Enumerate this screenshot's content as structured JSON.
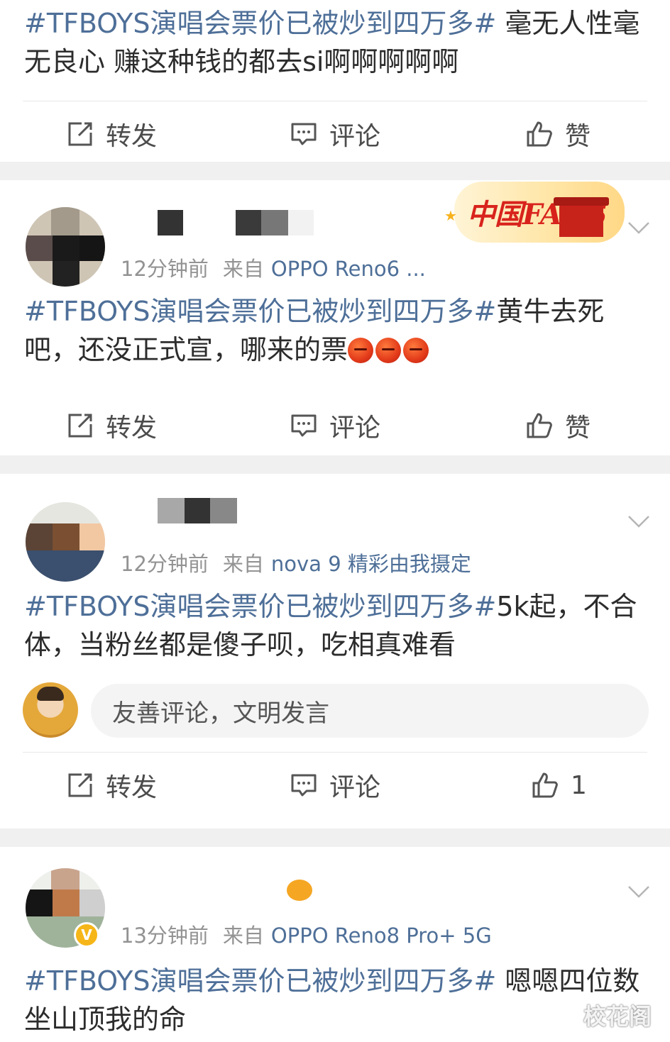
{
  "actions": {
    "repost": "转发",
    "comment": "评论",
    "like": "赞"
  },
  "posts": [
    {
      "hashtag": "#TFBOYS演唱会票价已被炒到四万多#",
      "text": " 毫无人性毫无良心 赚这种钱的都去si啊啊啊啊啊",
      "like_label": "赞"
    },
    {
      "time": "12分钟前",
      "source_prefix": "来自",
      "device": "OPPO Reno6 ...",
      "badge": "中国FANS",
      "hashtag": "#TFBOYS演唱会票价已被炒到四万多#",
      "text": "黄牛去死吧，还没正式宣，哪来的票",
      "like_label": "赞"
    },
    {
      "time": "12分钟前",
      "source_prefix": "来自",
      "device": "nova 9 精彩由我摄定",
      "hashtag": "#TFBOYS演唱会票价已被炒到四万多#",
      "text": "5k起，不合体，当粉丝都是傻子呗，吃相真难看",
      "comment_placeholder": "友善评论，文明发言",
      "like_label": "1"
    },
    {
      "time": "13分钟前",
      "source_prefix": "来自",
      "device": "OPPO Reno8 Pro+ 5G",
      "hashtag": "#TFBOYS演唱会票价已被炒到四万多#",
      "text": " 嗯嗯四位数坐山顶我的命"
    }
  ],
  "watermark": "校花阁",
  "colors": {
    "link": "#4e6f98",
    "meta": "#939393",
    "text": "#2c2c2c"
  }
}
